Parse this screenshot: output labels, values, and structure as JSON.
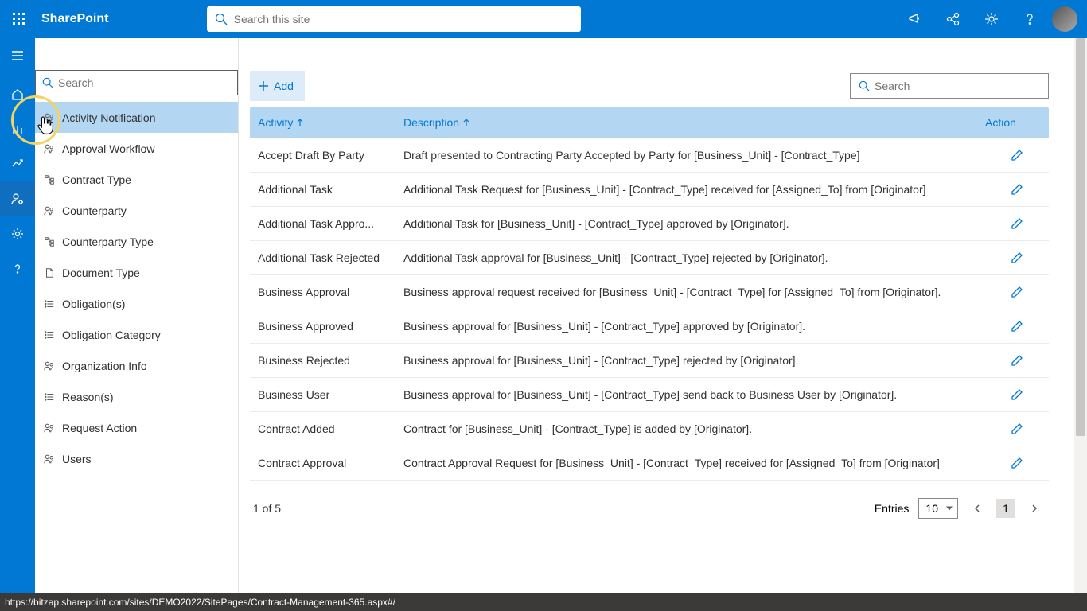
{
  "header": {
    "brand": "SharePoint",
    "search_placeholder": "Search this site"
  },
  "sidepanel": {
    "search_placeholder": "Search",
    "items": [
      {
        "label": "Activity Notification",
        "icon": "people-icon",
        "selected": true
      },
      {
        "label": "Approval Workflow",
        "icon": "people-icon"
      },
      {
        "label": "Contract Type",
        "icon": "tree-icon"
      },
      {
        "label": "Counterparty",
        "icon": "people-icon"
      },
      {
        "label": "Counterparty Type",
        "icon": "tree-icon"
      },
      {
        "label": "Document Type",
        "icon": "file-icon"
      },
      {
        "label": "Obligation(s)",
        "icon": "list-icon"
      },
      {
        "label": "Obligation Category",
        "icon": "list-icon"
      },
      {
        "label": "Organization Info",
        "icon": "people-icon"
      },
      {
        "label": "Reason(s)",
        "icon": "list-icon"
      },
      {
        "label": "Request Action",
        "icon": "people-icon"
      },
      {
        "label": "Users",
        "icon": "people-icon"
      }
    ]
  },
  "toolbar": {
    "add_label": "Add",
    "search_placeholder": "Search"
  },
  "table": {
    "headers": {
      "activity": "Activity",
      "description": "Description",
      "action": "Action"
    },
    "rows": [
      {
        "activity": "Accept Draft By Party",
        "description": "Draft presented to Contracting Party Accepted by Party for [Business_Unit] - [Contract_Type]"
      },
      {
        "activity": "Additional Task",
        "description": "Additional Task Request for [Business_Unit] - [Contract_Type] received for [Assigned_To] from [Originator]"
      },
      {
        "activity": "Additional Task Appro...",
        "description": "Additional Task for [Business_Unit] - [Contract_Type] approved by [Originator]."
      },
      {
        "activity": "Additional Task Rejected",
        "description": "Additional Task approval for [Business_Unit] - [Contract_Type] rejected by [Originator]."
      },
      {
        "activity": "Business Approval",
        "description": "Business approval request received for [Business_Unit] - [Contract_Type] for [Assigned_To] from [Originator]."
      },
      {
        "activity": "Business Approved",
        "description": "Business approval for [Business_Unit] - [Contract_Type] approved by [Originator]."
      },
      {
        "activity": "Business Rejected",
        "description": "Business approval for [Business_Unit] - [Contract_Type] rejected by [Originator]."
      },
      {
        "activity": "Business User",
        "description": "Business approval for [Business_Unit] - [Contract_Type] send back to Business User by [Originator]."
      },
      {
        "activity": "Contract Added",
        "description": "Contract for [Business_Unit] - [Contract_Type] is added by [Originator]."
      },
      {
        "activity": "Contract Approval",
        "description": "Contract Approval Request for [Business_Unit] - [Contract_Type] received for [Assigned_To] from [Originator]"
      }
    ]
  },
  "pager": {
    "summary": "1 of 5",
    "entries_label": "Entries",
    "entries_value": "10",
    "current_page": "1"
  },
  "statusbar": {
    "url": "https://bitzap.sharepoint.com/sites/DEMO2022/SitePages/Contract-Management-365.aspx#/"
  }
}
